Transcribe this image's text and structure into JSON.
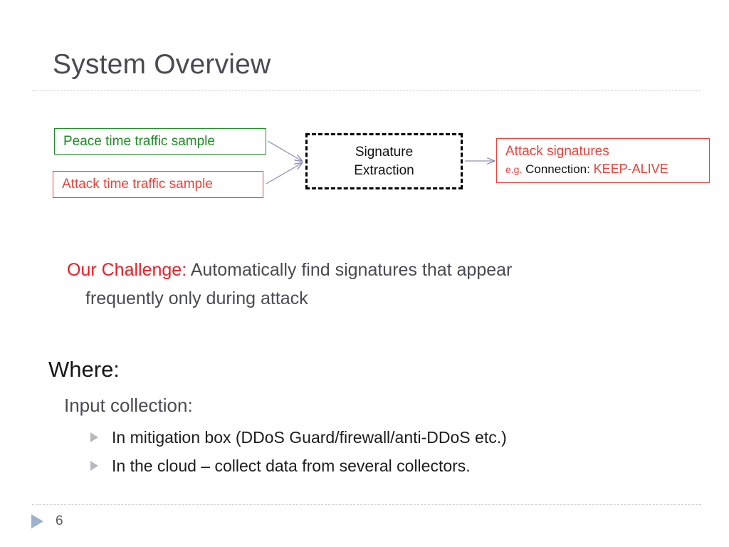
{
  "slide": {
    "title": "System Overview",
    "page_number": "6",
    "colors": {
      "title_gray": "#4a4a52",
      "green": "#1e8b26",
      "red": "#e8423a",
      "challenge_red": "#ee1c25",
      "arrow": "#8e93b8",
      "footer_marker": "#9eb1cc"
    }
  },
  "diagram": {
    "peace_box": {
      "label": "Peace time traffic sample"
    },
    "attack_box": {
      "label": "Attack time traffic sample"
    },
    "extraction_box": {
      "line1": "Signature",
      "line2": "Extraction"
    },
    "signatures_box": {
      "title": "Attack signatures",
      "eg": "e.g.",
      "key": "Connection:",
      "value": "KEEP-ALIVE"
    }
  },
  "challenge": {
    "label": "Our Challenge:",
    "line1": " Automatically find signatures that appear",
    "line2": "frequently only during attack"
  },
  "where": {
    "heading": "Where:",
    "subheading": "Input collection:",
    "bullets": [
      "In mitigation box (DDoS Guard/firewall/anti-DDoS etc.)",
      "In the cloud – collect data from several collectors."
    ]
  }
}
